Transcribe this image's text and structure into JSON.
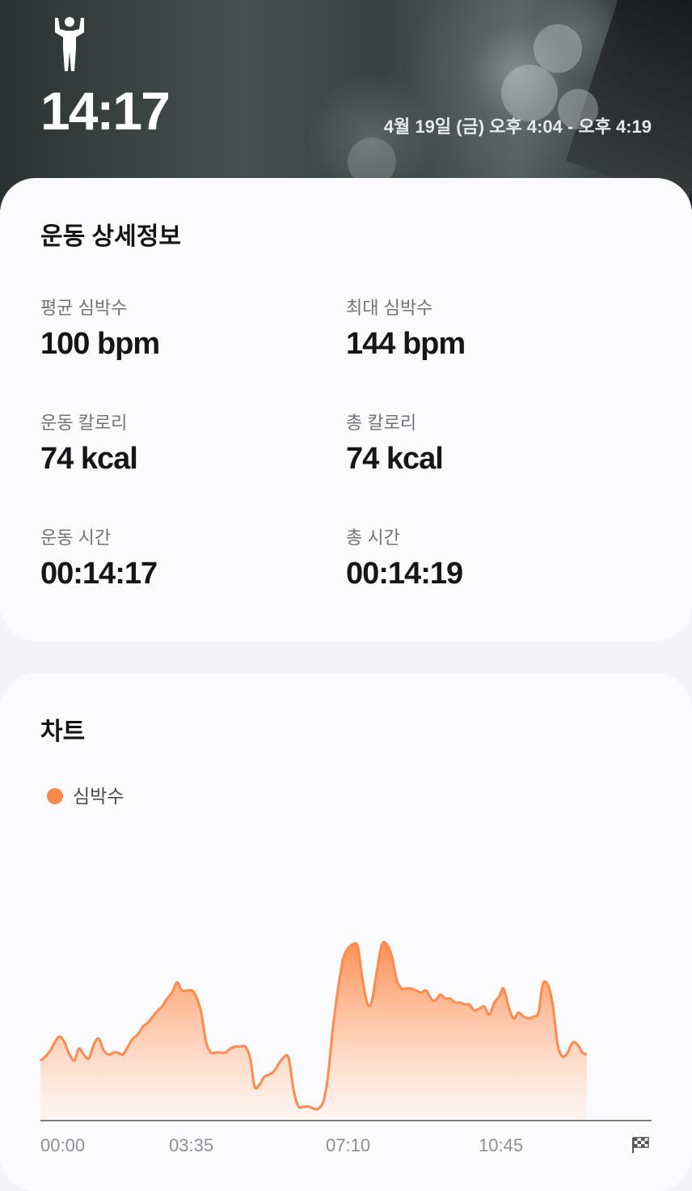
{
  "header": {
    "time": "14:17",
    "date_range": "4월 19일 (금) 오후 4:04 - 오후 4:19",
    "icon": "person-flexing-icon"
  },
  "details": {
    "title": "운동 상세정보",
    "stats": [
      {
        "label": "평균 심박수",
        "value": "100 bpm"
      },
      {
        "label": "최대 심박수",
        "value": "144 bpm"
      },
      {
        "label": "운동 칼로리",
        "value": "74 kcal"
      },
      {
        "label": "총 칼로리",
        "value": "74 kcal"
      },
      {
        "label": "운동 시간",
        "value": "00:14:17"
      },
      {
        "label": "총 시간",
        "value": "00:14:19"
      }
    ]
  },
  "chart": {
    "title": "차트",
    "legend": "심박수",
    "accent": "#ff8a4c",
    "fill_top": "#ff8a4c",
    "fill_bottom": "#fff3ec",
    "end_icon": "checkered-flag-icon"
  },
  "chart_data": {
    "type": "area",
    "x_tick_labels": [
      "00:00",
      "03:35",
      "07:10",
      "10:45"
    ],
    "x_tick_seconds": [
      0,
      215,
      430,
      645
    ],
    "x_range_seconds": [
      0,
      859
    ],
    "ylim": [
      55,
      150
    ],
    "grid": false,
    "legend_position": "top-left",
    "series": [
      {
        "name": "심박수",
        "points": [
          [
            0,
            85
          ],
          [
            7,
            87
          ],
          [
            14,
            90
          ],
          [
            20,
            94
          ],
          [
            27,
            97
          ],
          [
            34,
            94
          ],
          [
            41,
            88
          ],
          [
            48,
            85
          ],
          [
            54,
            91
          ],
          [
            61,
            88
          ],
          [
            68,
            86
          ],
          [
            75,
            93
          ],
          [
            82,
            96
          ],
          [
            89,
            90
          ],
          [
            96,
            88
          ],
          [
            103,
            89
          ],
          [
            109,
            89
          ],
          [
            116,
            88
          ],
          [
            123,
            92
          ],
          [
            130,
            96
          ],
          [
            137,
            98
          ],
          [
            144,
            102
          ],
          [
            151,
            104
          ],
          [
            158,
            107
          ],
          [
            165,
            110
          ],
          [
            171,
            112
          ],
          [
            178,
            116
          ],
          [
            185,
            119
          ],
          [
            192,
            124
          ],
          [
            199,
            120
          ],
          [
            206,
            120
          ],
          [
            213,
            120
          ],
          [
            219,
            117
          ],
          [
            226,
            109
          ],
          [
            233,
            94
          ],
          [
            240,
            89
          ],
          [
            247,
            89
          ],
          [
            254,
            89
          ],
          [
            260,
            89
          ],
          [
            267,
            91
          ],
          [
            274,
            92
          ],
          [
            281,
            92
          ],
          [
            288,
            92
          ],
          [
            295,
            86
          ],
          [
            301,
            72
          ],
          [
            308,
            73
          ],
          [
            315,
            77
          ],
          [
            322,
            78
          ],
          [
            329,
            80
          ],
          [
            336,
            84
          ],
          [
            343,
            87
          ],
          [
            349,
            86
          ],
          [
            356,
            70
          ],
          [
            363,
            62
          ],
          [
            370,
            62
          ],
          [
            377,
            62
          ],
          [
            384,
            61
          ],
          [
            391,
            61
          ],
          [
            398,
            65
          ],
          [
            404,
            77
          ],
          [
            411,
            101
          ],
          [
            418,
            120
          ],
          [
            425,
            135
          ],
          [
            432,
            141
          ],
          [
            439,
            143
          ],
          [
            446,
            142
          ],
          [
            453,
            125
          ],
          [
            460,
            113
          ],
          [
            466,
            115
          ],
          [
            473,
            130
          ],
          [
            480,
            143
          ],
          [
            487,
            143
          ],
          [
            494,
            137
          ],
          [
            501,
            125
          ],
          [
            508,
            121
          ],
          [
            514,
            121
          ],
          [
            521,
            121
          ],
          [
            528,
            120
          ],
          [
            535,
            119
          ],
          [
            542,
            120
          ],
          [
            549,
            116
          ],
          [
            555,
            115
          ],
          [
            562,
            118
          ],
          [
            569,
            116
          ],
          [
            576,
            116
          ],
          [
            583,
            114
          ],
          [
            590,
            114
          ],
          [
            596,
            113
          ],
          [
            603,
            113
          ],
          [
            610,
            110
          ],
          [
            617,
            111
          ],
          [
            624,
            112
          ],
          [
            631,
            108
          ],
          [
            638,
            114
          ],
          [
            645,
            117
          ],
          [
            651,
            121
          ],
          [
            658,
            112
          ],
          [
            665,
            106
          ],
          [
            672,
            109
          ],
          [
            679,
            107
          ],
          [
            686,
            106
          ],
          [
            693,
            107
          ],
          [
            700,
            109
          ],
          [
            706,
            123
          ],
          [
            713,
            123
          ],
          [
            720,
            113
          ],
          [
            727,
            93
          ],
          [
            734,
            87
          ],
          [
            741,
            89
          ],
          [
            748,
            94
          ],
          [
            755,
            93
          ],
          [
            762,
            89
          ],
          [
            768,
            88
          ]
        ]
      }
    ]
  }
}
